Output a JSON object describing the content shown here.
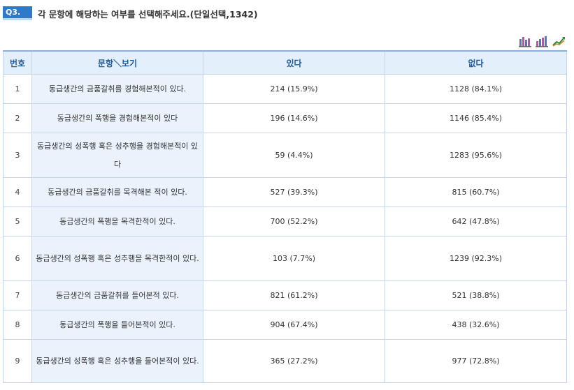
{
  "question": {
    "badge": "Q3.",
    "title": "각 문항에 해당하는 여부를 선택해주세요.(단일선택,1342)"
  },
  "icons": [
    "bar-chart-icon",
    "bar-chart-alt-icon",
    "line-chart-icon"
  ],
  "table": {
    "headers": [
      "번호",
      "문항＼보기",
      "있다",
      "없다"
    ],
    "rows": [
      {
        "no": "1",
        "label": "동급생간의 금품갈취를 경험해본적이 있다.",
        "yes": "214 (15.9%)",
        "no_ans": "1128 (84.1%)"
      },
      {
        "no": "2",
        "label": "동급생간의 폭행을 경험해본적이 있다",
        "yes": "196 (14.6%)",
        "no_ans": "1146 (85.4%)"
      },
      {
        "no": "3",
        "label": "동급생간의 성폭행 혹은 성추행을 경험해본적이 있다",
        "yes": "59 (4.4%)",
        "no_ans": "1283 (95.6%)"
      },
      {
        "no": "4",
        "label": "동급생간의 금품갈취를 목격해본 적이 있다.",
        "yes": "527 (39.3%)",
        "no_ans": "815 (60.7%)"
      },
      {
        "no": "5",
        "label": "동급생간의 폭행을 목격한적이 있다.",
        "yes": "700 (52.2%)",
        "no_ans": "642 (47.8%)"
      },
      {
        "no": "6",
        "label": "동급생간의 성폭행 혹은 성추행을 목격한적이 있다.",
        "yes": "103 (7.7%)",
        "no_ans": "1239 (92.3%)"
      },
      {
        "no": "7",
        "label": "동급생간의 금품갈취를 들어본적 있다.",
        "yes": "821 (61.2%)",
        "no_ans": "521 (38.8%)"
      },
      {
        "no": "8",
        "label": "동급생간의 폭행을 들어본적이 있다.",
        "yes": "904 (67.4%)",
        "no_ans": "438 (32.6%)"
      },
      {
        "no": "9",
        "label": "동급생간의 성폭행 혹은 성추행을 들어본적이 있다.",
        "yes": "365 (27.2%)",
        "no_ans": "977 (72.8%)"
      }
    ]
  }
}
